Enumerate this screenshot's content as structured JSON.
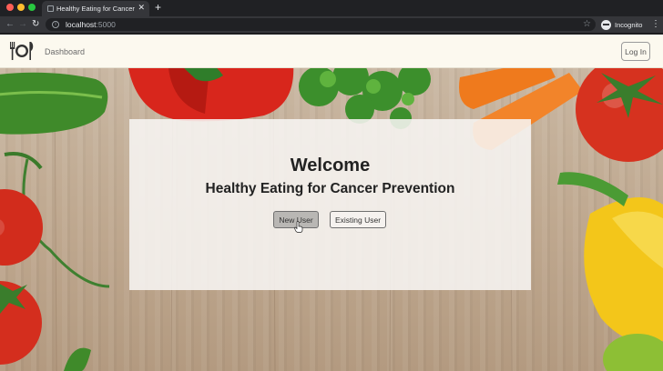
{
  "browser": {
    "tab_title": "Healthy Eating for Cancer Prev",
    "tab_close": "✕",
    "new_tab": "+",
    "url_host": "localhost",
    "url_port": ":5000",
    "profile_label": "Incognito",
    "icons": {
      "back": "arrow-left-icon",
      "forward": "arrow-right-icon",
      "reload": "reload-icon",
      "info": "info-icon",
      "bookmark": "star-icon",
      "menu": "kebab-menu-icon"
    }
  },
  "navbar": {
    "brand_icon": "plate-and-cutlery-icon",
    "dashboard_link": "Dashboard",
    "login_button": "Log In",
    "background_color": "#fcf9ef"
  },
  "hero": {
    "title": "Welcome",
    "subtitle": "Healthy Eating for Cancer Prevention",
    "new_user_button": "New User",
    "existing_user_button": "Existing User"
  }
}
